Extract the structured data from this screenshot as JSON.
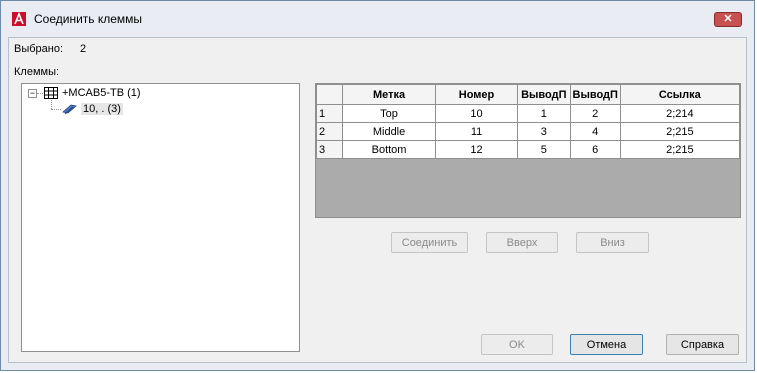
{
  "window": {
    "title": "Соединить клеммы",
    "close_glyph": "✕"
  },
  "selected": {
    "label": "Выбрано:",
    "value": "2"
  },
  "terminals_label": "Клеммы:",
  "tree": {
    "root": {
      "expander": "−",
      "label": "+MCAB5-TB (1)"
    },
    "child": {
      "label": "10, .  (3)"
    }
  },
  "grid": {
    "columns": [
      "",
      "Метка",
      "Номер",
      "ВыводП",
      "ВыводП",
      "Ссылка"
    ],
    "rows": [
      {
        "num": "1",
        "mark": "Top",
        "number": "10",
        "pin1": "1",
        "pin2": "2",
        "ref": "2;214"
      },
      {
        "num": "2",
        "mark": "Middle",
        "number": "11",
        "pin1": "3",
        "pin2": "4",
        "ref": "2;215"
      },
      {
        "num": "3",
        "mark": "Bottom",
        "number": "12",
        "pin1": "5",
        "pin2": "6",
        "ref": "2;215"
      }
    ]
  },
  "buttons": {
    "connect": "Соединить",
    "up": "Вверх",
    "down": "Вниз",
    "ok": "OK",
    "cancel": "Отмена",
    "help": "Справка"
  },
  "colors": {
    "accent_red": "#c8102e",
    "close_red": "#c75050"
  }
}
